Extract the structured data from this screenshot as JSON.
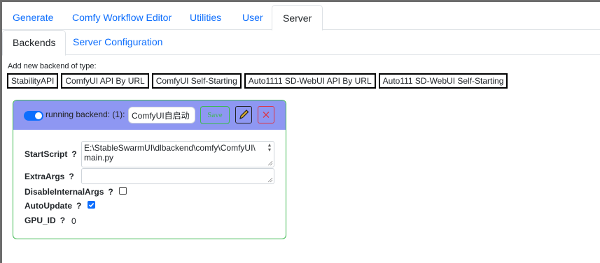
{
  "top_tabs": [
    {
      "label": "Generate",
      "active": false
    },
    {
      "label": "Comfy Workflow Editor",
      "active": false
    },
    {
      "label": "Utilities",
      "active": false
    },
    {
      "label": "User",
      "active": false
    },
    {
      "label": "Server",
      "active": true
    }
  ],
  "sub_tabs": [
    {
      "label": "Backends",
      "active": true
    },
    {
      "label": "Server Configuration",
      "active": false
    }
  ],
  "add_backend": {
    "label": "Add new backend of type:",
    "types": [
      "StabilityAPI",
      "ComfyUI API By URL",
      "ComfyUI Self-Starting",
      "Auto1111 SD-WebUI API By URL",
      "Auto111 SD-WebUI Self-Starting"
    ]
  },
  "backend": {
    "enabled": true,
    "status_text": "running backend: (1):",
    "title": "ComfyUI自启动",
    "save_label": "Save",
    "header_color": "#8e97f2",
    "border_color": "#3cb94f",
    "fields": {
      "start_script": {
        "label": "StartScript",
        "help": "?",
        "value_line1": "E:\\StableSwarmUI\\dlbackend\\comfy\\ComfyUI\\",
        "value_line2": "main.py"
      },
      "extra_args": {
        "label": "ExtraArgs",
        "help": "?",
        "value": ""
      },
      "disable_internal_args": {
        "label": "DisableInternalArgs",
        "help": "?",
        "checked": false
      },
      "auto_update": {
        "label": "AutoUpdate",
        "help": "?",
        "checked": true
      },
      "gpu_id": {
        "label": "GPU_ID",
        "help": "?",
        "value": "0"
      }
    }
  },
  "icons": {
    "edit": "pencil-icon",
    "delete": "close-icon"
  }
}
